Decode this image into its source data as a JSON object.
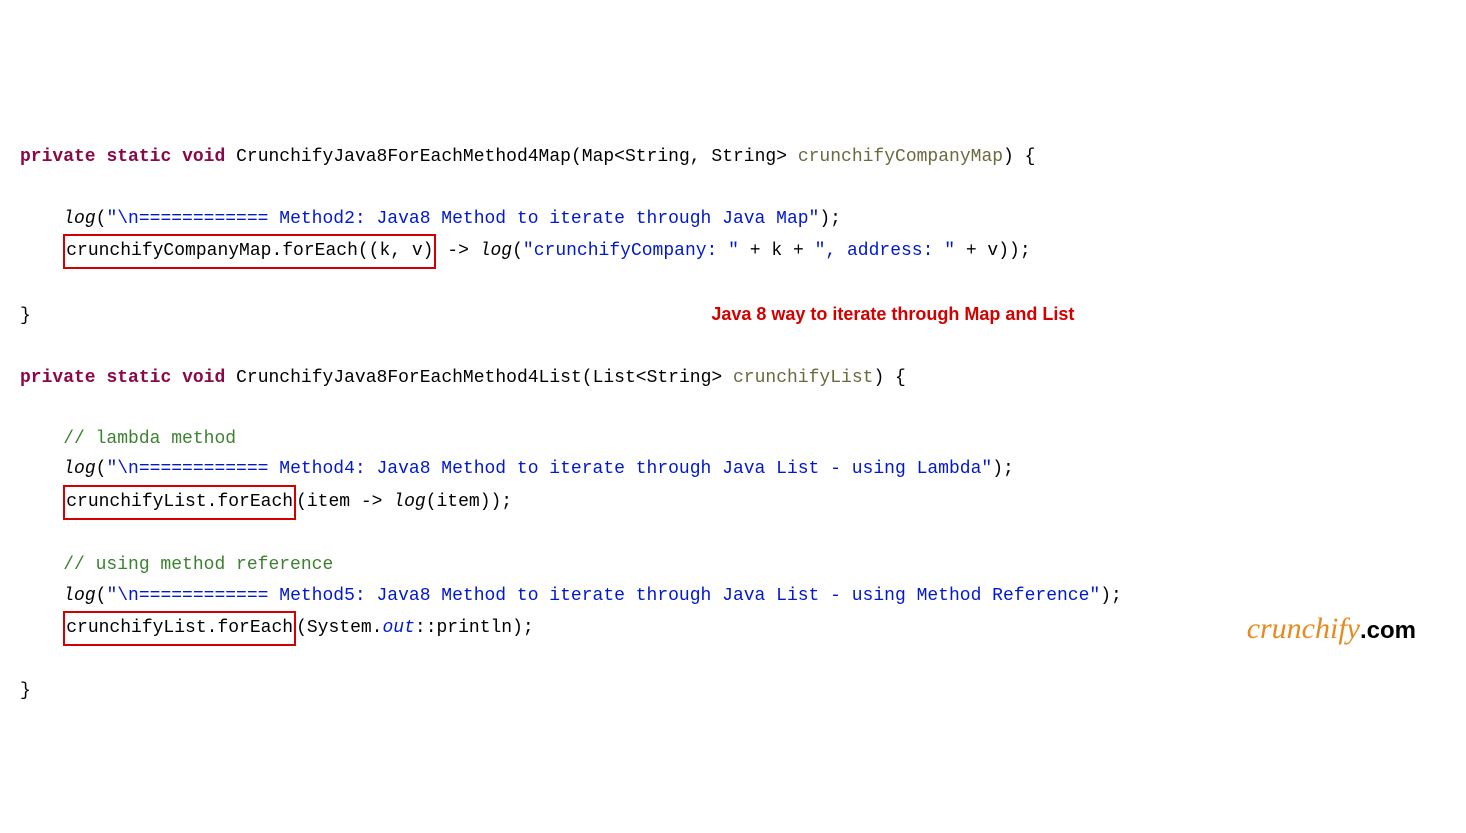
{
  "line1": {
    "kw1": "private",
    "kw2": "static",
    "kw3": "void",
    "method": "CrunchifyJava8ForEachMethod4Map",
    "type": "Map<String, String>",
    "param": "crunchifyCompanyMap",
    "brace": ") {"
  },
  "line2": {
    "call": "log",
    "str": "\"\\n============ Method2: Java8 Method to iterate through Java Map\"",
    "close": ");"
  },
  "line3": {
    "box": "crunchifyCompanyMap.forEach((k, v)",
    "arrow": " -> ",
    "call": "log",
    "str1": "\"crunchifyCompany: \"",
    "plus1": " + k + ",
    "str2": "\", address: \"",
    "plus2": " + v));"
  },
  "annotation": "Java 8 way to iterate through Map and List",
  "line5": {
    "kw1": "private",
    "kw2": "static",
    "kw3": "void",
    "method": "CrunchifyJava8ForEachMethod4List",
    "type": "List<String>",
    "param": "crunchifyList",
    "brace": ") {"
  },
  "comment1": "// lambda method",
  "line7": {
    "call": "log",
    "str": "\"\\n============ Method4: Java8 Method to iterate through Java List - using Lambda\"",
    "close": ");"
  },
  "line8": {
    "box": "crunchifyList.forEach",
    "rest": "(item -> ",
    "call": "log",
    "close": "(item));"
  },
  "comment2": "// using method reference",
  "line10": {
    "call": "log",
    "str": "\"\\n============ Method5: Java8 Method to iterate through Java List - using Method Reference\"",
    "close": ");"
  },
  "line11": {
    "box": "crunchifyList.forEach",
    "open": "(System.",
    "out": "out",
    "rest": "::println);"
  },
  "watermark": {
    "brand": "crunchify",
    "dotcom": ".com"
  }
}
